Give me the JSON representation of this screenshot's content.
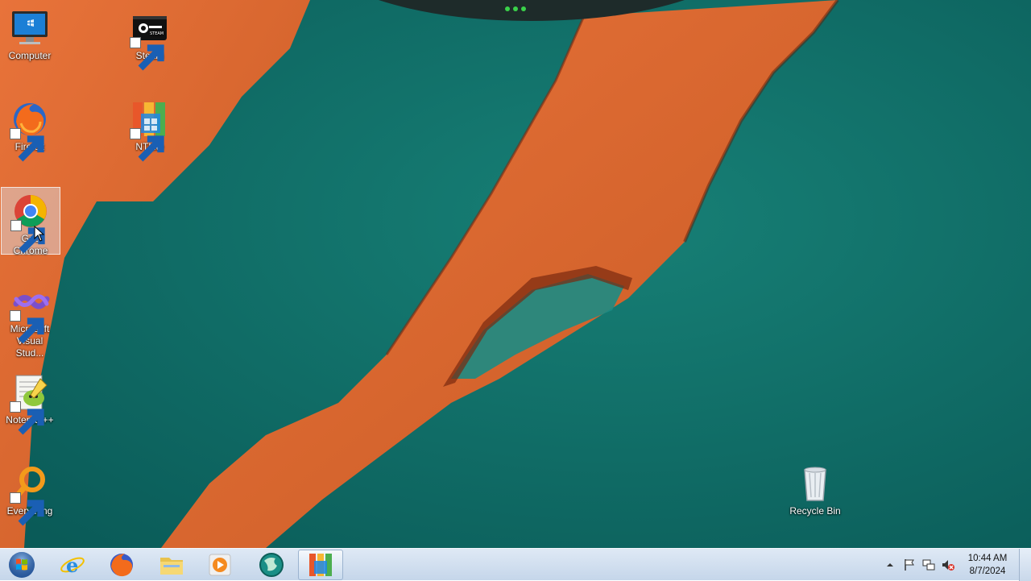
{
  "desktop": {
    "icons": [
      {
        "label": "Computer",
        "icon": "computer-icon"
      },
      {
        "label": "Steam",
        "icon": "steam-icon"
      },
      {
        "label": "Firefox",
        "icon": "firefox-icon"
      },
      {
        "label": "NTLite",
        "icon": "ntlite-icon"
      },
      {
        "label": "Google Chrome",
        "label_line1": "Goo",
        "label_line2": "Chrome",
        "icon": "chrome-icon",
        "selected": true
      },
      {
        "label_line1": "Microsoft",
        "label_line2": "Visual Stud...",
        "icon": "visual-studio-icon"
      },
      {
        "label": "Notepad++",
        "icon": "notepad-plus-plus-icon"
      },
      {
        "label": "Everything",
        "icon": "everything-search-icon"
      },
      {
        "label": "Recycle Bin",
        "icon": "recycle-bin-icon"
      }
    ]
  },
  "taskbar": {
    "start_icon": "windows-start-orb-icon",
    "pinned": [
      {
        "name": "internet-explorer",
        "icon": "internet-explorer-icon"
      },
      {
        "name": "firefox",
        "icon": "firefox-icon"
      },
      {
        "name": "file-explorer",
        "icon": "folder-icon"
      },
      {
        "name": "media-player",
        "icon": "media-player-icon"
      },
      {
        "name": "unknown-app",
        "icon": "globe-app-icon"
      },
      {
        "name": "ntlite",
        "icon": "ntlite-icon",
        "active": true
      }
    ],
    "tray": {
      "icons": [
        "show-hidden-icons-arrow",
        "action-center-flag-icon",
        "network-icon",
        "volume-muted-icon"
      ],
      "time": "10:44 AM",
      "date": "8/7/2024"
    }
  },
  "colors": {
    "sea": "#0f6f6a",
    "sand": "#e07030",
    "taskbar": "#d5e2f1"
  }
}
